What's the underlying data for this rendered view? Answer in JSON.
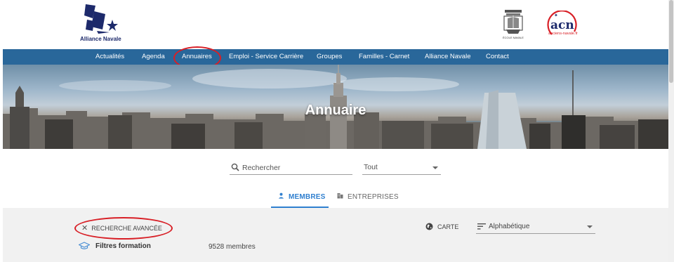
{
  "header": {
    "brand_text": "Alliance Navale",
    "ecole_logo_text": "ÉCOLE NAVALE",
    "acn_logo_text": "acn",
    "acn_logo_sub": "anciens-navale.fr"
  },
  "nav": {
    "items": [
      {
        "label": "Actualités"
      },
      {
        "label": "Agenda"
      },
      {
        "label": "Annuaires"
      },
      {
        "label": "Emploi - Service Carrière"
      },
      {
        "label": "Groupes"
      },
      {
        "label": "Familles - Carnet"
      },
      {
        "label": "Alliance Navale"
      },
      {
        "label": "Contact"
      }
    ],
    "background": "#29679a"
  },
  "hero": {
    "title": "Annuaire"
  },
  "search": {
    "placeholder": "Rechercher",
    "type_value": "Tout"
  },
  "tabs": [
    {
      "label": "MEMBRES",
      "active": true
    },
    {
      "label": "ENTREPRISES",
      "active": false
    }
  ],
  "filters": {
    "advanced_search_label": "RECHERCHE AVANCÉE",
    "map_label": "CARTE",
    "sort_value": "Alphabétique",
    "formation_filters_label": "Filtres formation",
    "member_count": "9528 membres"
  },
  "colors": {
    "accent": "#2f7fcf",
    "highlight_circle": "#d81f26",
    "brand_navy": "#1d2a6b"
  }
}
